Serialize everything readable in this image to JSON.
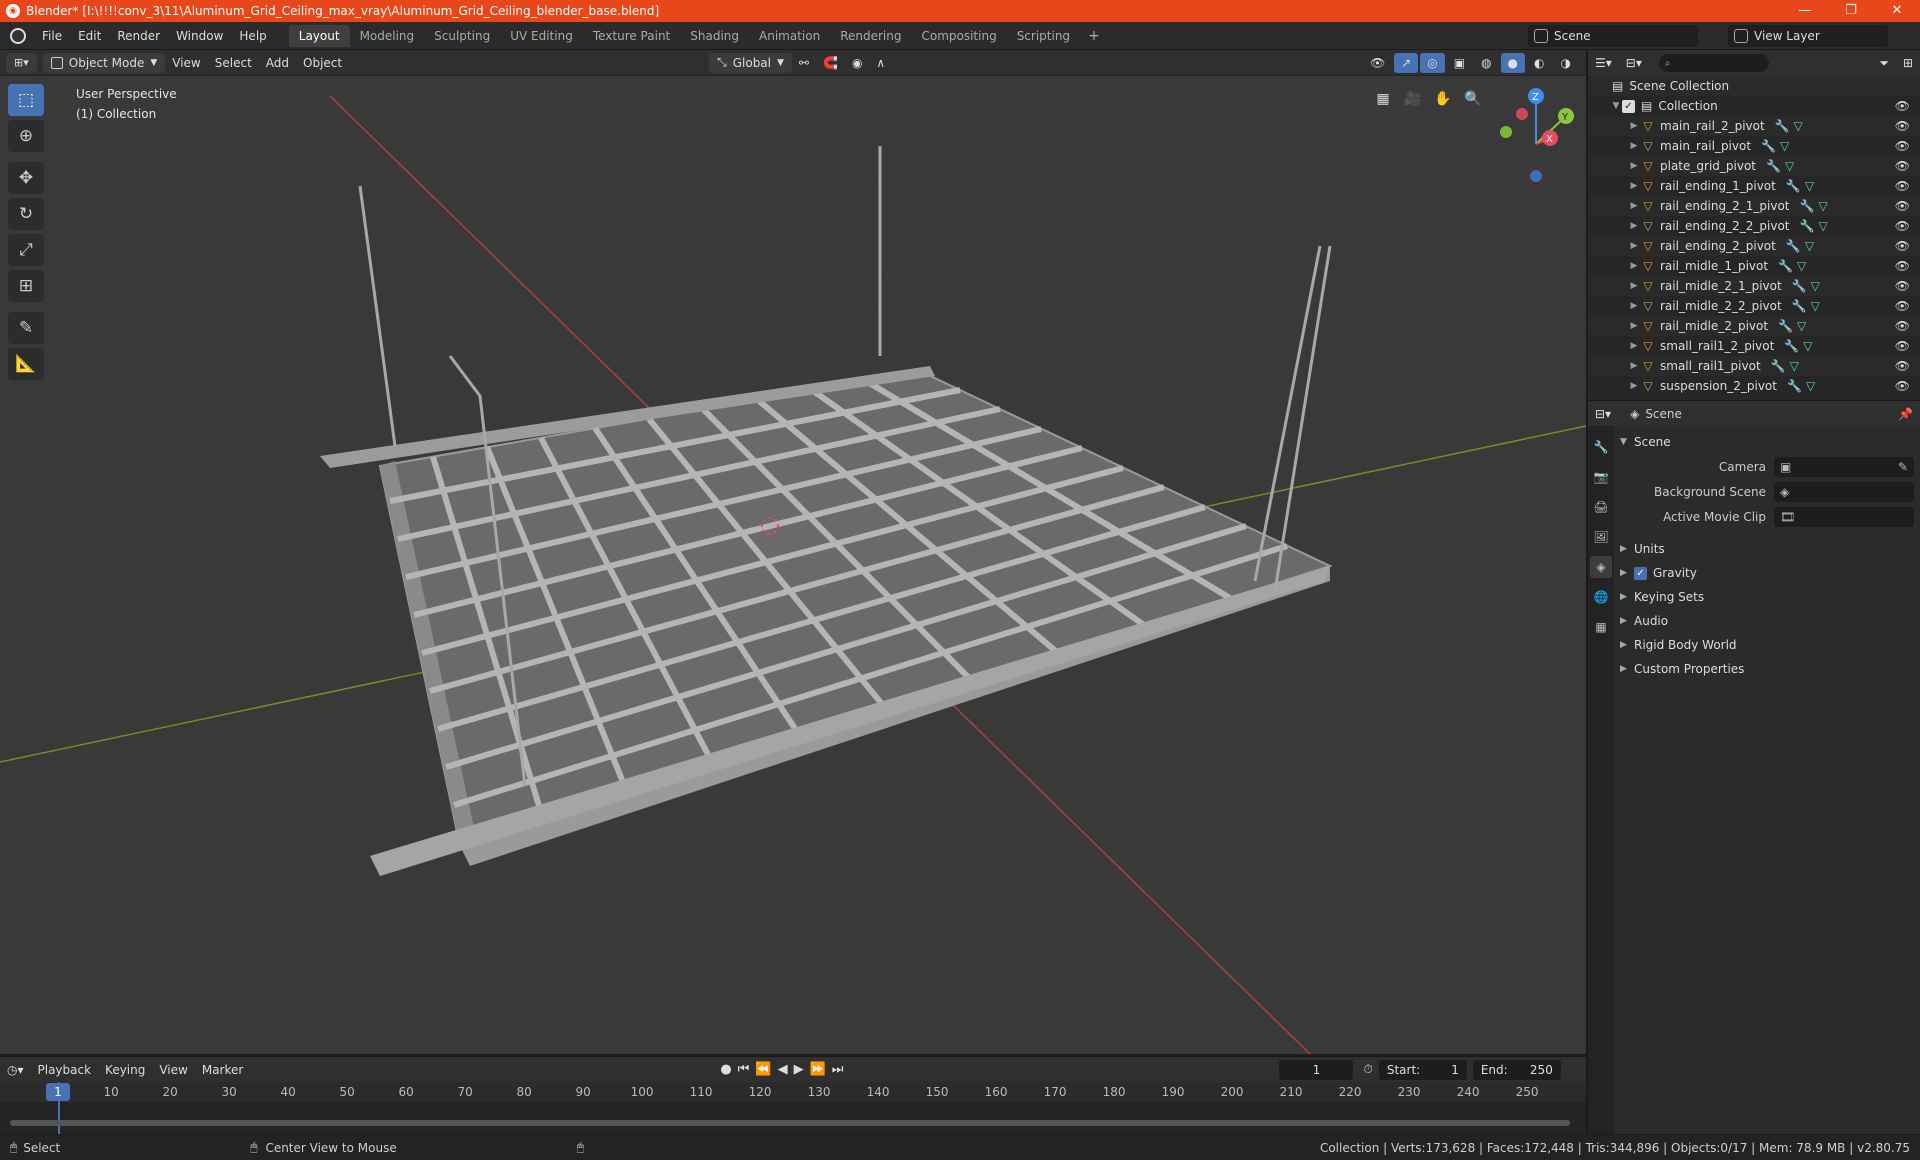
{
  "window": {
    "title": "Blender* [I:\\!!!!conv_3\\11\\Aluminum_Grid_Ceiling_max_vray\\Aluminum_Grid_Ceiling_blender_base.blend]",
    "minimize": "—",
    "maximize": "❐",
    "close": "✕"
  },
  "menu": [
    "File",
    "Edit",
    "Render",
    "Window",
    "Help"
  ],
  "workspaces": [
    "Layout",
    "Modeling",
    "Sculpting",
    "UV Editing",
    "Texture Paint",
    "Shading",
    "Animation",
    "Rendering",
    "Compositing",
    "Scripting"
  ],
  "workspace_add": "+",
  "scene_selector": "Scene",
  "view_layer_selector": "View Layer",
  "viewport_header": {
    "mode": "Object Mode",
    "menus": [
      "View",
      "Select",
      "Add",
      "Object"
    ],
    "orientation": "Global"
  },
  "viewport": {
    "perspective": "User Perspective",
    "collection": "(1) Collection",
    "axes": {
      "z": "Z",
      "y": "Y",
      "x": "X"
    }
  },
  "tools": [
    "select-box-icon",
    "cursor-icon",
    "move-icon",
    "rotate-icon",
    "scale-icon",
    "transform-icon",
    "annotate-icon",
    "measure-icon"
  ],
  "outliner": {
    "root": "Scene Collection",
    "collection": "Collection",
    "items": [
      "main_rail_2_pivot",
      "main_rail_pivot",
      "plate_grid_pivot",
      "rail_ending_1_pivot",
      "rail_ending_2_1_pivot",
      "rail_ending_2_2_pivot",
      "rail_ending_2_pivot",
      "rail_midle_1_pivot",
      "rail_midle_2_1_pivot",
      "rail_midle_2_2_pivot",
      "rail_midle_2_pivot",
      "small_rail1_2_pivot",
      "small_rail1_pivot",
      "suspension_2_pivot"
    ]
  },
  "properties": {
    "header": "Scene",
    "panel": "Scene",
    "camera_label": "Camera",
    "background_scene_label": "Background Scene",
    "active_movie_clip_label": "Active Movie Clip",
    "sections": [
      "Units",
      "Gravity",
      "Keying Sets",
      "Audio",
      "Rigid Body World",
      "Custom Properties"
    ]
  },
  "timeline": {
    "menus": [
      "Playback",
      "Keying",
      "View",
      "Marker"
    ],
    "current_frame": "1",
    "start_label": "Start:",
    "start": "1",
    "end_label": "End:",
    "end": "250",
    "ticks": [
      "10",
      "20",
      "30",
      "40",
      "50",
      "60",
      "70",
      "80",
      "90",
      "100",
      "110",
      "120",
      "130",
      "140",
      "150",
      "160",
      "170",
      "180",
      "190",
      "200",
      "210",
      "220",
      "230",
      "240",
      "250"
    ],
    "playhead_label": "1"
  },
  "status": {
    "left": "Select",
    "middle": "Center View to Mouse",
    "right": "Collection | Verts:173,628 | Faces:172,448 | Tris:344,896 | Objects:0/17 | Mem: 78.9 MB | v2.80.75"
  },
  "colors": {
    "titlebar": "#e8471c",
    "accent": "#4772b3",
    "mesh_icon": "#e8923a",
    "axis_x": "#e84a5f",
    "axis_y": "#8cc63f",
    "axis_z": "#3f8ee8"
  }
}
